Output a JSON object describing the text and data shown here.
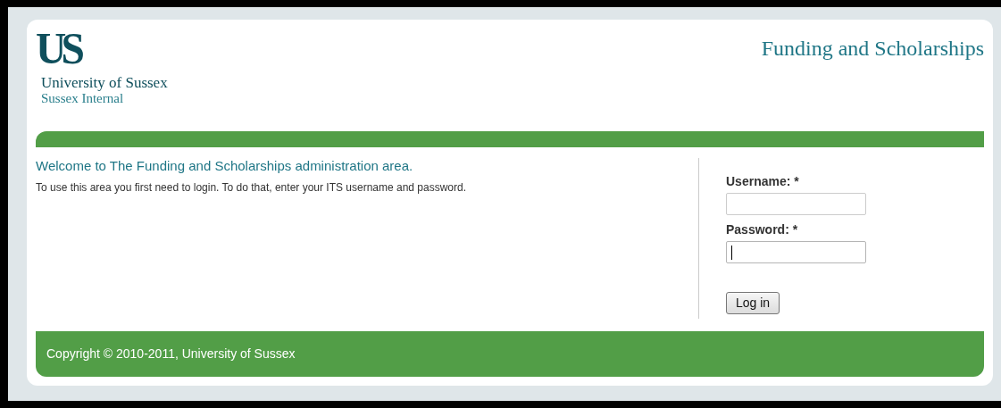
{
  "header": {
    "logo_mark": "US",
    "logo_name": "University of Sussex",
    "logo_subtitle": "Sussex Internal",
    "site_title": "Funding and Scholarships"
  },
  "main": {
    "heading": "Welcome to The Funding and Scholarships administration area.",
    "text": "To use this area you first need to login. To do that, enter your ITS username and password."
  },
  "login": {
    "fields": [
      {
        "label": "Username: *",
        "focused": false
      },
      {
        "label": "Password: *",
        "focused": true
      }
    ],
    "button": "Log in"
  },
  "footer": {
    "copyright": "Copyright © 2010-2011, University of Sussex"
  }
}
